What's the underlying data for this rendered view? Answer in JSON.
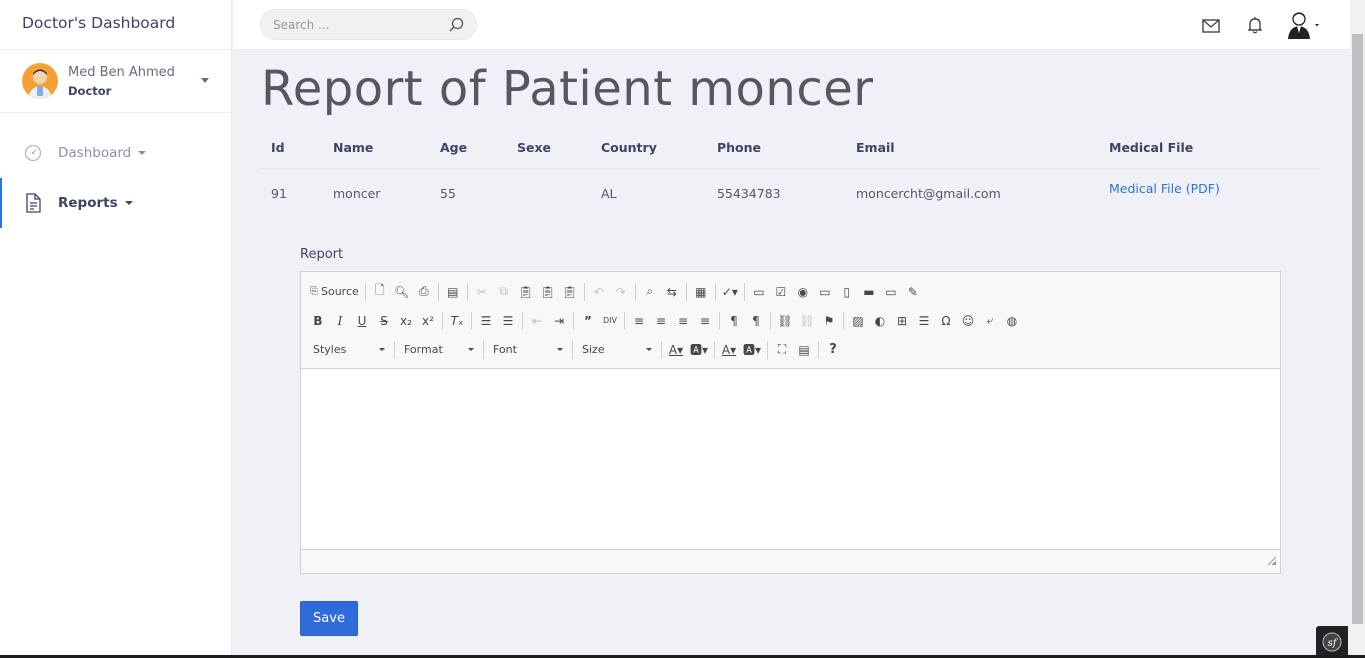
{
  "sidebar": {
    "brand": "Doctor's Dashboard",
    "user_name": "Med Ben Ahmed",
    "user_role": "Doctor",
    "items": [
      {
        "label": "Dashboard",
        "icon": "dashboard-gauge-icon"
      },
      {
        "label": "Reports",
        "icon": "document-icon"
      }
    ]
  },
  "header": {
    "search_placeholder": "Search ...",
    "icons": [
      "mail-icon",
      "bell-icon",
      "user-avatar-icon"
    ]
  },
  "main": {
    "title": "Report of Patient moncer",
    "table": {
      "columns": [
        "Id",
        "Name",
        "Age",
        "Sexe",
        "Country",
        "Phone",
        "Email",
        "Medical File"
      ],
      "row": {
        "id": "91",
        "name": "moncer",
        "age": "55",
        "sexe": "",
        "country": "AL",
        "phone": "55434783",
        "email": "moncercht@gmail.com",
        "medical_file": "Medical File (PDF)"
      }
    },
    "report_label": "Report",
    "editor": {
      "source_label": "Source",
      "styles_label": "Styles",
      "format_label": "Format",
      "font_label": "Font",
      "size_label": "Size",
      "help_label": "?"
    },
    "save_label": "Save"
  },
  "colors": {
    "accent": "#2f6bdb",
    "link": "#2f72d8",
    "background": "#f0f0f7",
    "avatar": "#f7a134"
  }
}
